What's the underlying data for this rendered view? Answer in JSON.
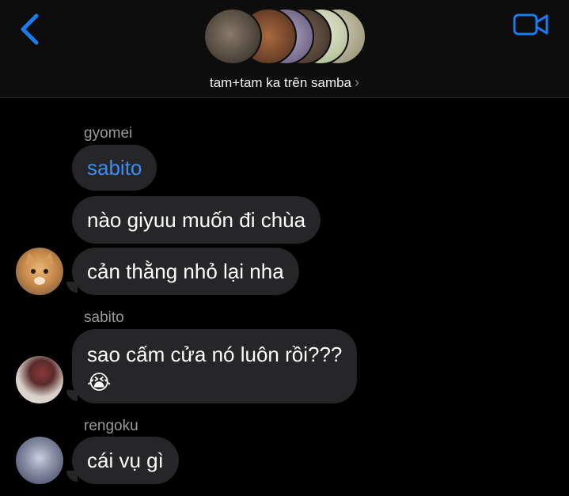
{
  "header": {
    "group_name": "tam+tam ka trên samba",
    "chevron": "›",
    "back_icon": "chevron-left-icon",
    "video_icon": "video-camera-icon",
    "accent_color": "#1a7cf0"
  },
  "messages": [
    {
      "sender": "gyomei",
      "bubbles": [
        {
          "text": "sabito",
          "style": "mention"
        },
        {
          "text": "nào giyuu muốn đi chùa"
        },
        {
          "text": "cản thằng nhỏ lại nha"
        }
      ]
    },
    {
      "sender": "sabito",
      "bubbles": [
        {
          "text": "sao cấm cửa nó luôn rồi???",
          "emoji": "😭"
        }
      ]
    },
    {
      "sender": "rengoku",
      "bubbles": [
        {
          "text": "cái vụ gì"
        }
      ]
    }
  ]
}
